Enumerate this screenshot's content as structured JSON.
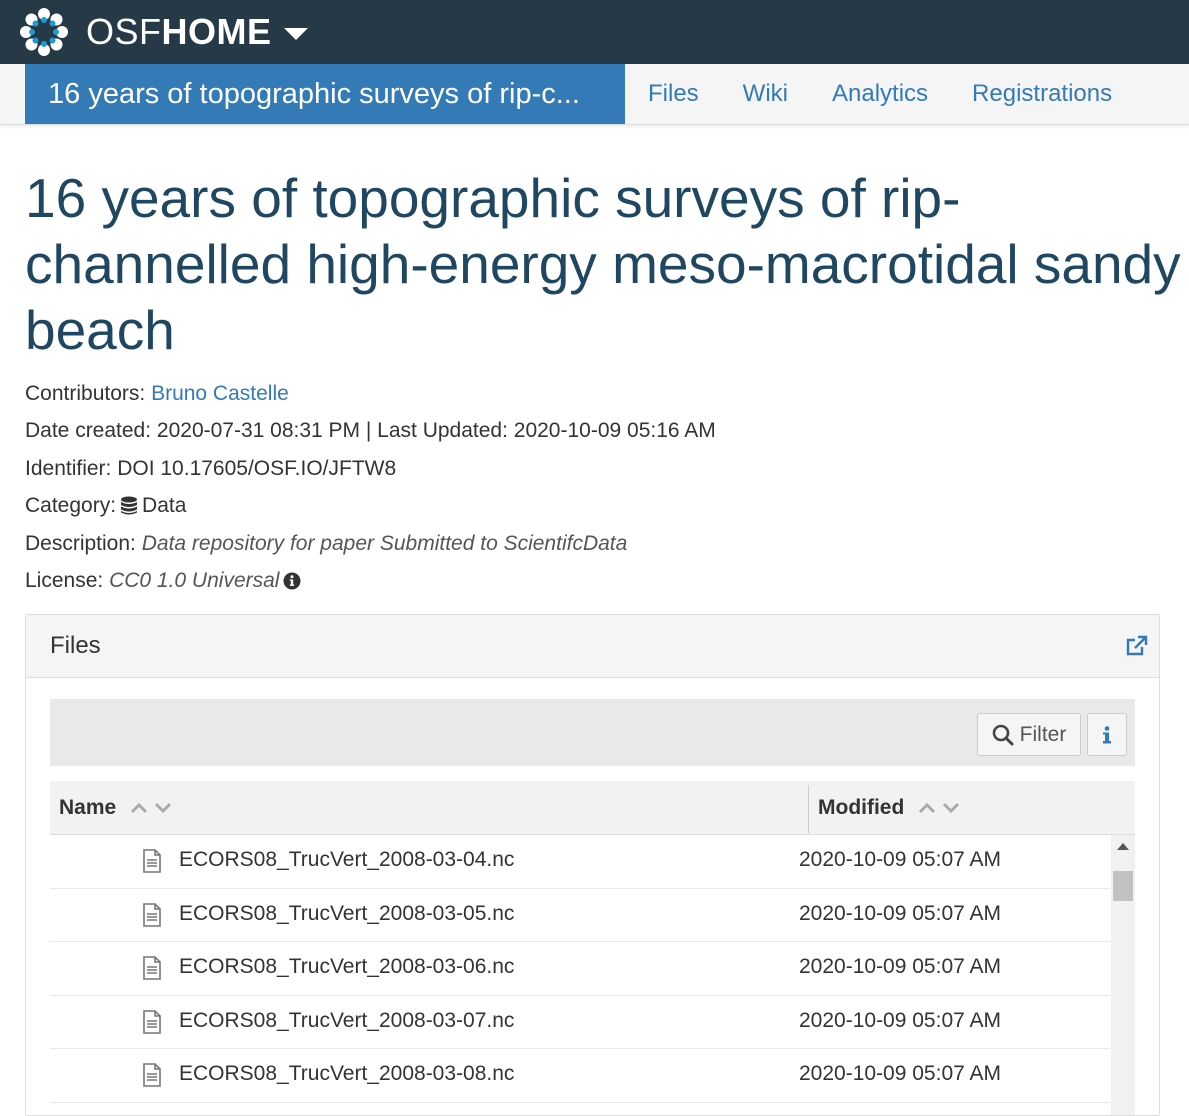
{
  "brand": {
    "name_light": "OSF",
    "name_bold": "HOME"
  },
  "project_nav": {
    "title": "16 years of topographic surveys of rip-c...",
    "links": [
      "Files",
      "Wiki",
      "Analytics",
      "Registrations"
    ]
  },
  "project": {
    "title": "16 years of topographic surveys of rip-channelled high-energy meso-macrotidal sandy beach",
    "contributors_label": "Contributors:",
    "contributors": "Bruno Castelle",
    "dates": "Date created: 2020-07-31 08:31 PM | Last Updated: 2020-10-09 05:16 AM",
    "identifier": "Identifier: DOI 10.17605/OSF.IO/JFTW8",
    "category_label": "Category:",
    "category": "Data",
    "description_label": "Description:",
    "description": "Data repository for paper Submitted to ScientifcData",
    "license_label": "License:",
    "license": "CC0 1.0 Universal"
  },
  "files_panel": {
    "title": "Files",
    "filter_label": "Filter",
    "columns": {
      "name": "Name",
      "modified": "Modified"
    },
    "rows": [
      {
        "name": "ECORS08_TrucVert_2008-03-04.nc",
        "modified": "2020-10-09 05:07 AM"
      },
      {
        "name": "ECORS08_TrucVert_2008-03-05.nc",
        "modified": "2020-10-09 05:07 AM"
      },
      {
        "name": "ECORS08_TrucVert_2008-03-06.nc",
        "modified": "2020-10-09 05:07 AM"
      },
      {
        "name": "ECORS08_TrucVert_2008-03-07.nc",
        "modified": "2020-10-09 05:07 AM"
      },
      {
        "name": "ECORS08_TrucVert_2008-03-08.nc",
        "modified": "2020-10-09 05:07 AM"
      }
    ]
  },
  "icons": [
    "osf-logo-icon",
    "caret-down-icon",
    "database-icon",
    "info-circle-icon",
    "external-link-icon",
    "search-icon",
    "info-icon",
    "sort-up-icon",
    "sort-down-icon",
    "file-icon"
  ],
  "colors": {
    "topbar": "#263947",
    "accent": "#337ab7",
    "title": "#204762"
  }
}
